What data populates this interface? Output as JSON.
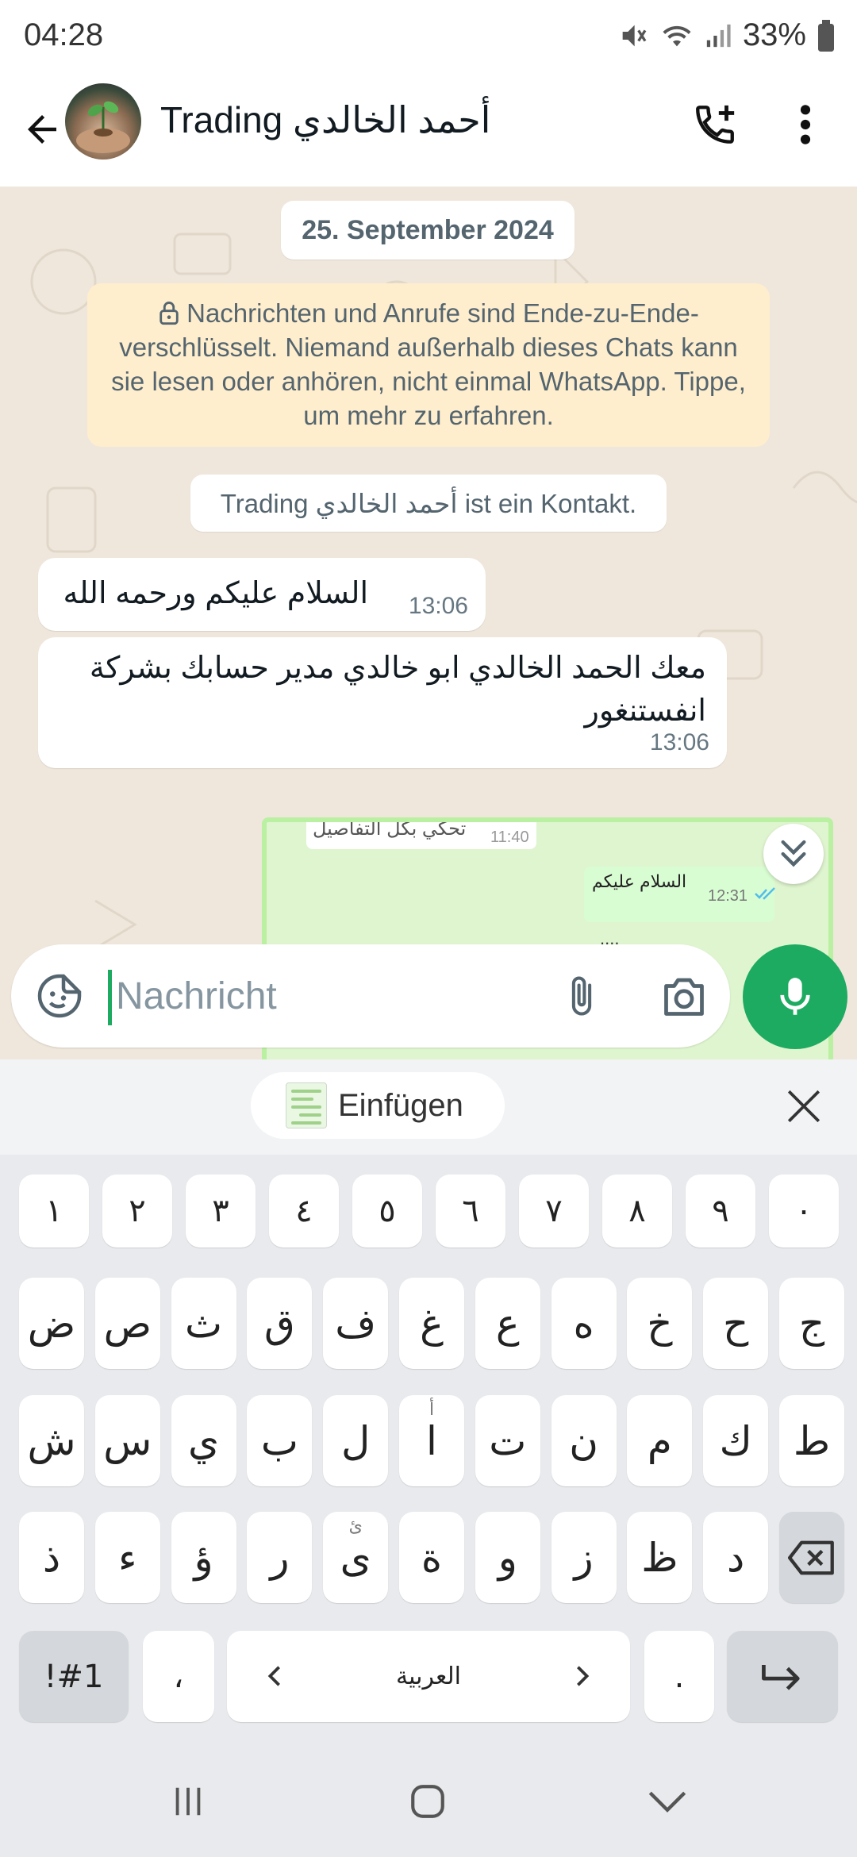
{
  "status_bar": {
    "time": "04:28",
    "battery": "33%",
    "icons": [
      "mute-icon",
      "wifi-icon",
      "signal-icon",
      "battery-icon"
    ]
  },
  "header": {
    "contact_name": "Trading أحمد الخالدي",
    "icons": [
      "back-arrow-icon",
      "avatar",
      "add-call-icon",
      "more-vert-icon"
    ]
  },
  "chat": {
    "date_label": "25. September 2024",
    "encryption_notice": "Nachrichten und Anrufe sind Ende-zu-Ende-verschlüsselt. Niemand außerhalb dieses Chats kann sie lesen oder anhören, nicht einmal WhatsApp. Tippe, um mehr zu erfahren.",
    "contact_notice": "Trading أحمد الخالدي ist ein Kontakt.",
    "messages": [
      {
        "text": "السلام عليكم ورحمه الله",
        "time": "13:06",
        "direction": "incoming"
      },
      {
        "text": "معك الحمد الخالدي ابو خالدي مدير حسابك بشركة انفستنغور",
        "time": "13:06",
        "direction": "incoming"
      }
    ],
    "shared_image": {
      "top_text": "تحكي بكل التفاصيل",
      "top_time": "11:40",
      "msg_text": "السلام عليكم",
      "msg_time": "12:31",
      "bottom_text": "...."
    }
  },
  "input": {
    "placeholder": "Nachricht",
    "value": ""
  },
  "keyboard": {
    "paste_label": "Einfügen",
    "row_numbers": [
      "١",
      "٢",
      "٣",
      "٤",
      "٥",
      "٦",
      "٧",
      "٨",
      "٩",
      "٠"
    ],
    "row1": [
      "ض",
      "ص",
      "ث",
      "ق",
      "ف",
      "غ",
      "ع",
      "ه",
      "خ",
      "ح",
      "ج"
    ],
    "row2": [
      "ش",
      "س",
      "ي",
      "ب",
      "ل",
      "ا",
      "ت",
      "ن",
      "م",
      "ك",
      "ط"
    ],
    "row3": [
      "ذ",
      "ء",
      "ؤ",
      "ر",
      "ى",
      "ة",
      "و",
      "ز",
      "ظ",
      "د"
    ],
    "row2_hints": [
      "",
      "",
      "",
      "",
      "",
      "أ",
      "",
      "",
      "",
      "",
      ""
    ],
    "row3_hints": [
      "",
      "",
      "",
      "",
      "ئ",
      "",
      "",
      "",
      "",
      ""
    ],
    "symbols_key": "!#1",
    "comma_key": "،",
    "language_label": "العربية",
    "period_key": "."
  },
  "colors": {
    "accent": "#1daa61",
    "chat_background": "#efe7dc",
    "notice_background": "#ffeecd"
  }
}
